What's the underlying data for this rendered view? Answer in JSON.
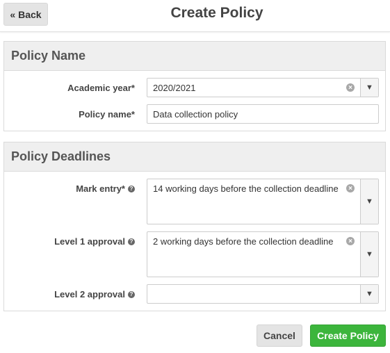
{
  "header": {
    "back_label": "« Back",
    "title": "Create Policy"
  },
  "policy_name_section": {
    "heading": "Policy Name",
    "academic_year": {
      "label": "Academic year*",
      "value": "2020/2021"
    },
    "policy_name": {
      "label": "Policy name*",
      "value": "Data collection policy"
    }
  },
  "deadlines_section": {
    "heading": "Policy Deadlines",
    "mark_entry": {
      "label": "Mark entry*",
      "value": "14 working days before the collection deadline"
    },
    "level1": {
      "label": "Level 1 approval",
      "value": "2 working days before the collection deadline"
    },
    "level2": {
      "label": "Level 2 approval",
      "value": ""
    }
  },
  "icons": {
    "help": "?",
    "clear": "×",
    "caret": "▼"
  },
  "footer": {
    "cancel_label": "Cancel",
    "create_label": "Create Policy"
  },
  "colors": {
    "primary": "#3cb53c",
    "panel_header": "#efefef"
  }
}
